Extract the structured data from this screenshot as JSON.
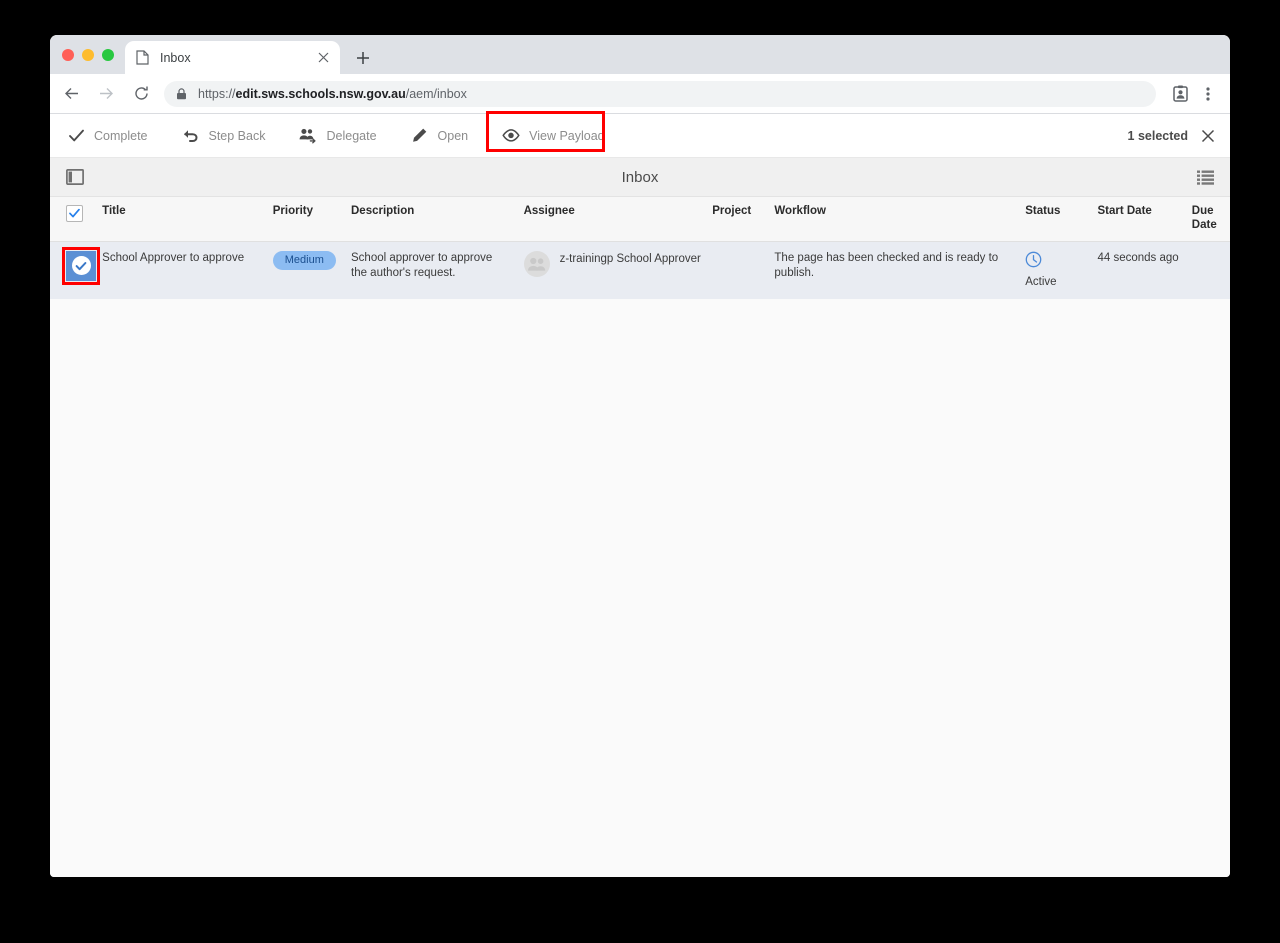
{
  "browser": {
    "tab": {
      "title": "Inbox",
      "favicon_icon": "page-icon",
      "close_icon": "close-icon"
    },
    "new_tab_icon": "plus-icon",
    "nav": {
      "back_icon": "arrow-left-icon",
      "forward_icon": "arrow-right-icon",
      "reload_icon": "reload-icon"
    },
    "omnibox": {
      "lock_icon": "lock-icon",
      "scheme": "https://",
      "host": "edit.sws.schools.nsw.gov.au",
      "path": "/aem/inbox",
      "full_url": "https://edit.sws.schools.nsw.gov.au/aem/inbox"
    },
    "profile_icon": "profile-card-icon",
    "menu_icon": "three-dot-menu-icon"
  },
  "toolbar": {
    "actions": [
      {
        "label": "Complete",
        "icon": "checkmark-icon"
      },
      {
        "label": "Step Back",
        "icon": "undo-arrow-icon"
      },
      {
        "label": "Delegate",
        "icon": "people-delegate-icon"
      },
      {
        "label": "Open",
        "icon": "pencil-icon"
      },
      {
        "label": "View Payload",
        "icon": "eye-icon"
      }
    ],
    "selection_text": "1 selected",
    "clear_icon": "close-icon",
    "highlight_color": "#ff0000"
  },
  "inbox_header": {
    "rail_toggle_icon": "rail-toggle-icon",
    "title": "Inbox",
    "list_view_icon": "list-view-icon"
  },
  "table": {
    "columns": [
      {
        "key": "select",
        "label": ""
      },
      {
        "key": "title",
        "label": "Title"
      },
      {
        "key": "priority",
        "label": "Priority"
      },
      {
        "key": "description",
        "label": "Description"
      },
      {
        "key": "assignee",
        "label": "Assignee"
      },
      {
        "key": "project",
        "label": "Project"
      },
      {
        "key": "workflow",
        "label": "Workflow"
      },
      {
        "key": "status",
        "label": "Status"
      },
      {
        "key": "start_date",
        "label": "Start Date"
      },
      {
        "key": "due_date",
        "label": "Due Date"
      }
    ],
    "header_checkbox_checked": true,
    "header_check_icon": "checkmark-icon",
    "rows": [
      {
        "selected": true,
        "check_icon": "check-circle-icon",
        "title": "School Approver to approve",
        "priority": "Medium",
        "priority_color": "#8cbcf2",
        "description": "School approver to approve the author's request.",
        "assignee": "z-trainingp School Approver",
        "assignee_avatar_icon": "group-avatar-icon",
        "project": "",
        "workflow": "The page has been checked and is ready to publish.",
        "status": "Active",
        "status_icon": "clock-icon",
        "status_color": "#4c8ad8",
        "start_date": "44 seconds ago",
        "due_date": ""
      }
    ]
  }
}
